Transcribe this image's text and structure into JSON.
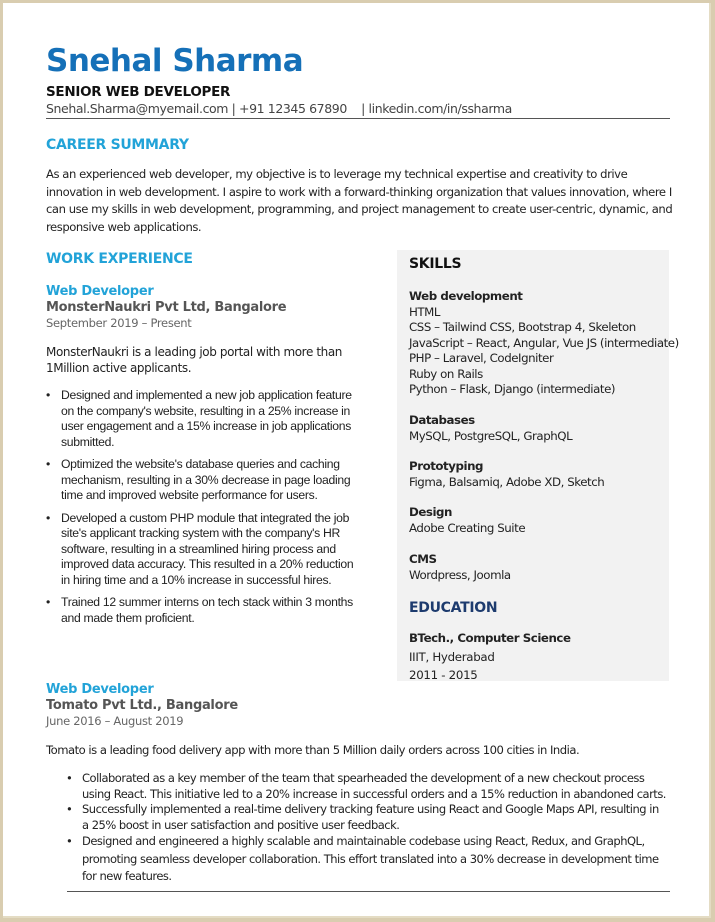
{
  "header": {
    "name": "Snehal Sharma",
    "role": "SENIOR WEB DEVELOPER",
    "contact": "Snehal.Sharma@myemail.com | +91 12345 67890    | linkedin.com/in/ssharma"
  },
  "summary": {
    "heading": "CAREER SUMMARY",
    "text": "As an experienced web developer, my objective is to leverage my technical expertise and creativity to drive innovation in web development. I aspire to work with a forward-thinking organization that values innovation, where I can use my skills in web development, programming, and project management to create user-centric, dynamic, and responsive web applications."
  },
  "experience": {
    "heading": "WORK EXPERIENCE",
    "jobs": [
      {
        "title": "Web Developer",
        "company": "MonsterNaukri Pvt Ltd, Bangalore",
        "dates": "September 2019 – Present",
        "description": "MonsterNaukri is a leading job portal with more than 1Million active applicants.",
        "bullets": [
          "Designed and implemented a new job application feature on the company's website, resulting in a 25% increase in user engagement and a 15% increase in job applications submitted.",
          "Optimized the website's database queries and caching mechanism, resulting in a 30% decrease in page loading time and improved website performance for users.",
          "Developed a custom PHP module that integrated the job site's applicant tracking system with the company's HR software, resulting in a streamlined hiring process and improved data accuracy. This resulted in a 20% reduction in hiring time and a 10% increase in successful hires.",
          "Trained 12 summer interns on tech stack within 3 months and made them proficient."
        ]
      },
      {
        "title": "Web Developer",
        "company": "Tomato Pvt Ltd., Bangalore",
        "dates": "June 2016 – August 2019",
        "description": "Tomato is a leading food delivery app with more than 5 Million daily orders across 100 cities in India.",
        "bullets": [
          "Collaborated as a key member of the team that spearheaded the development of a new checkout process using React. This initiative led to a 20% increase in successful orders and a 15% reduction in abandoned carts.",
          "Successfully implemented a real-time delivery tracking feature using React and Google Maps API, resulting in a 25% boost in user satisfaction and positive user feedback.",
          "Designed and engineered a highly scalable and maintainable codebase using React, Redux, and GraphQL, promoting seamless developer collaboration. This effort translated into a 30% decrease in development time for new features."
        ]
      }
    ]
  },
  "skills": {
    "heading": "SKILLS",
    "groups": [
      {
        "category": "Web development",
        "items": [
          "HTML",
          "CSS – Tailwind CSS, Bootstrap 4, Skeleton",
          "JavaScript – React, Angular, Vue JS (intermediate)",
          "PHP – Laravel, CodeIgniter",
          "Ruby on Rails",
          "Python – Flask, Django (intermediate)"
        ]
      },
      {
        "category": "Databases",
        "items": [
          "MySQL, PostgreSQL, GraphQL"
        ]
      },
      {
        "category": "Prototyping",
        "items": [
          "Figma, Balsamiq, Adobe XD, Sketch"
        ]
      },
      {
        "category": "Design",
        "items": [
          "Adobe Creating Suite"
        ]
      },
      {
        "category": "CMS",
        "items": [
          "Wordpress, Joomla"
        ]
      }
    ]
  },
  "education": {
    "heading": "EDUCATION",
    "degree": "BTech., Computer Science",
    "school": "IIIT, Hyderabad",
    "years": "2011 - 2015"
  }
}
